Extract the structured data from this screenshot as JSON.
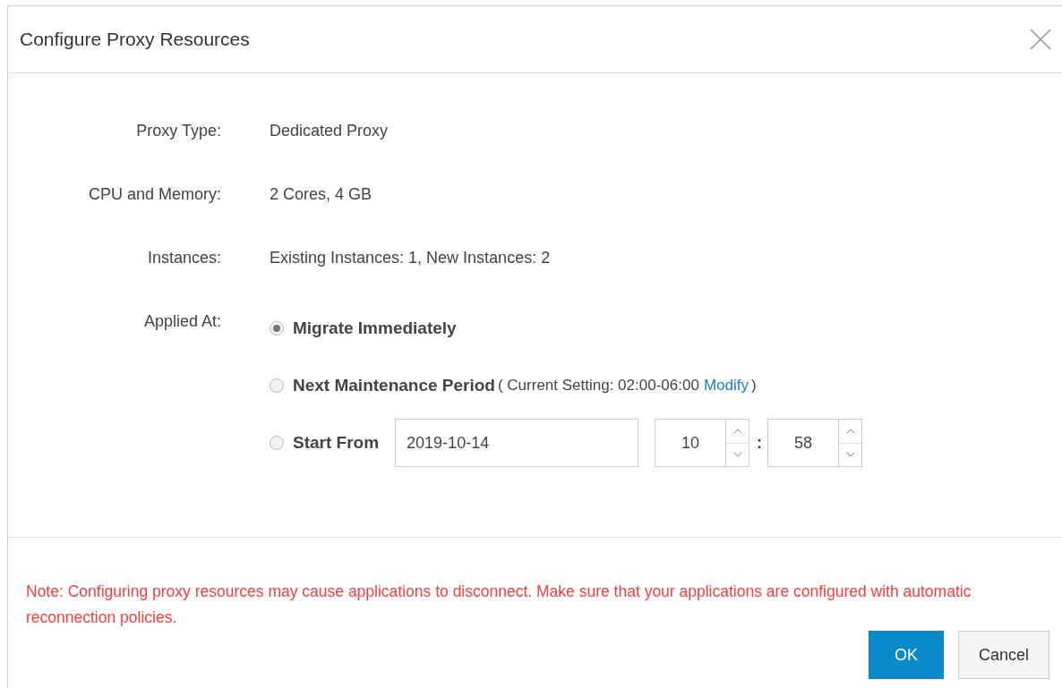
{
  "dialog": {
    "title": "Configure Proxy Resources"
  },
  "fields": [
    {
      "label": "Proxy Type:",
      "value": "Dedicated Proxy"
    },
    {
      "label": "CPU and Memory:",
      "value": "2 Cores, 4 GB"
    },
    {
      "label": "Instances:",
      "value": "Existing Instances: 1, New Instances: 2"
    }
  ],
  "applied_at": {
    "label": "Applied At:",
    "options": [
      {
        "kind": "plain",
        "label": "Migrate Immediately",
        "selected": true
      },
      {
        "kind": "maintenance",
        "label": "Next Maintenance Period",
        "detail": "( Current Setting: 02:00-06:00",
        "link": "Modify",
        "detail_end": ")",
        "selected": false
      },
      {
        "kind": "schedule",
        "label": "Start From",
        "date": "2019-10-14",
        "hour": "10",
        "separator": ":",
        "minute": "58",
        "selected": false
      }
    ]
  },
  "note": "Note: Configuring proxy resources may cause applications to disconnect. Make sure that your applications are configured with automatic reconnection policies.",
  "buttons": [
    {
      "kind": "primary",
      "label": "OK"
    },
    {
      "kind": "secondary",
      "label": "Cancel"
    }
  ]
}
